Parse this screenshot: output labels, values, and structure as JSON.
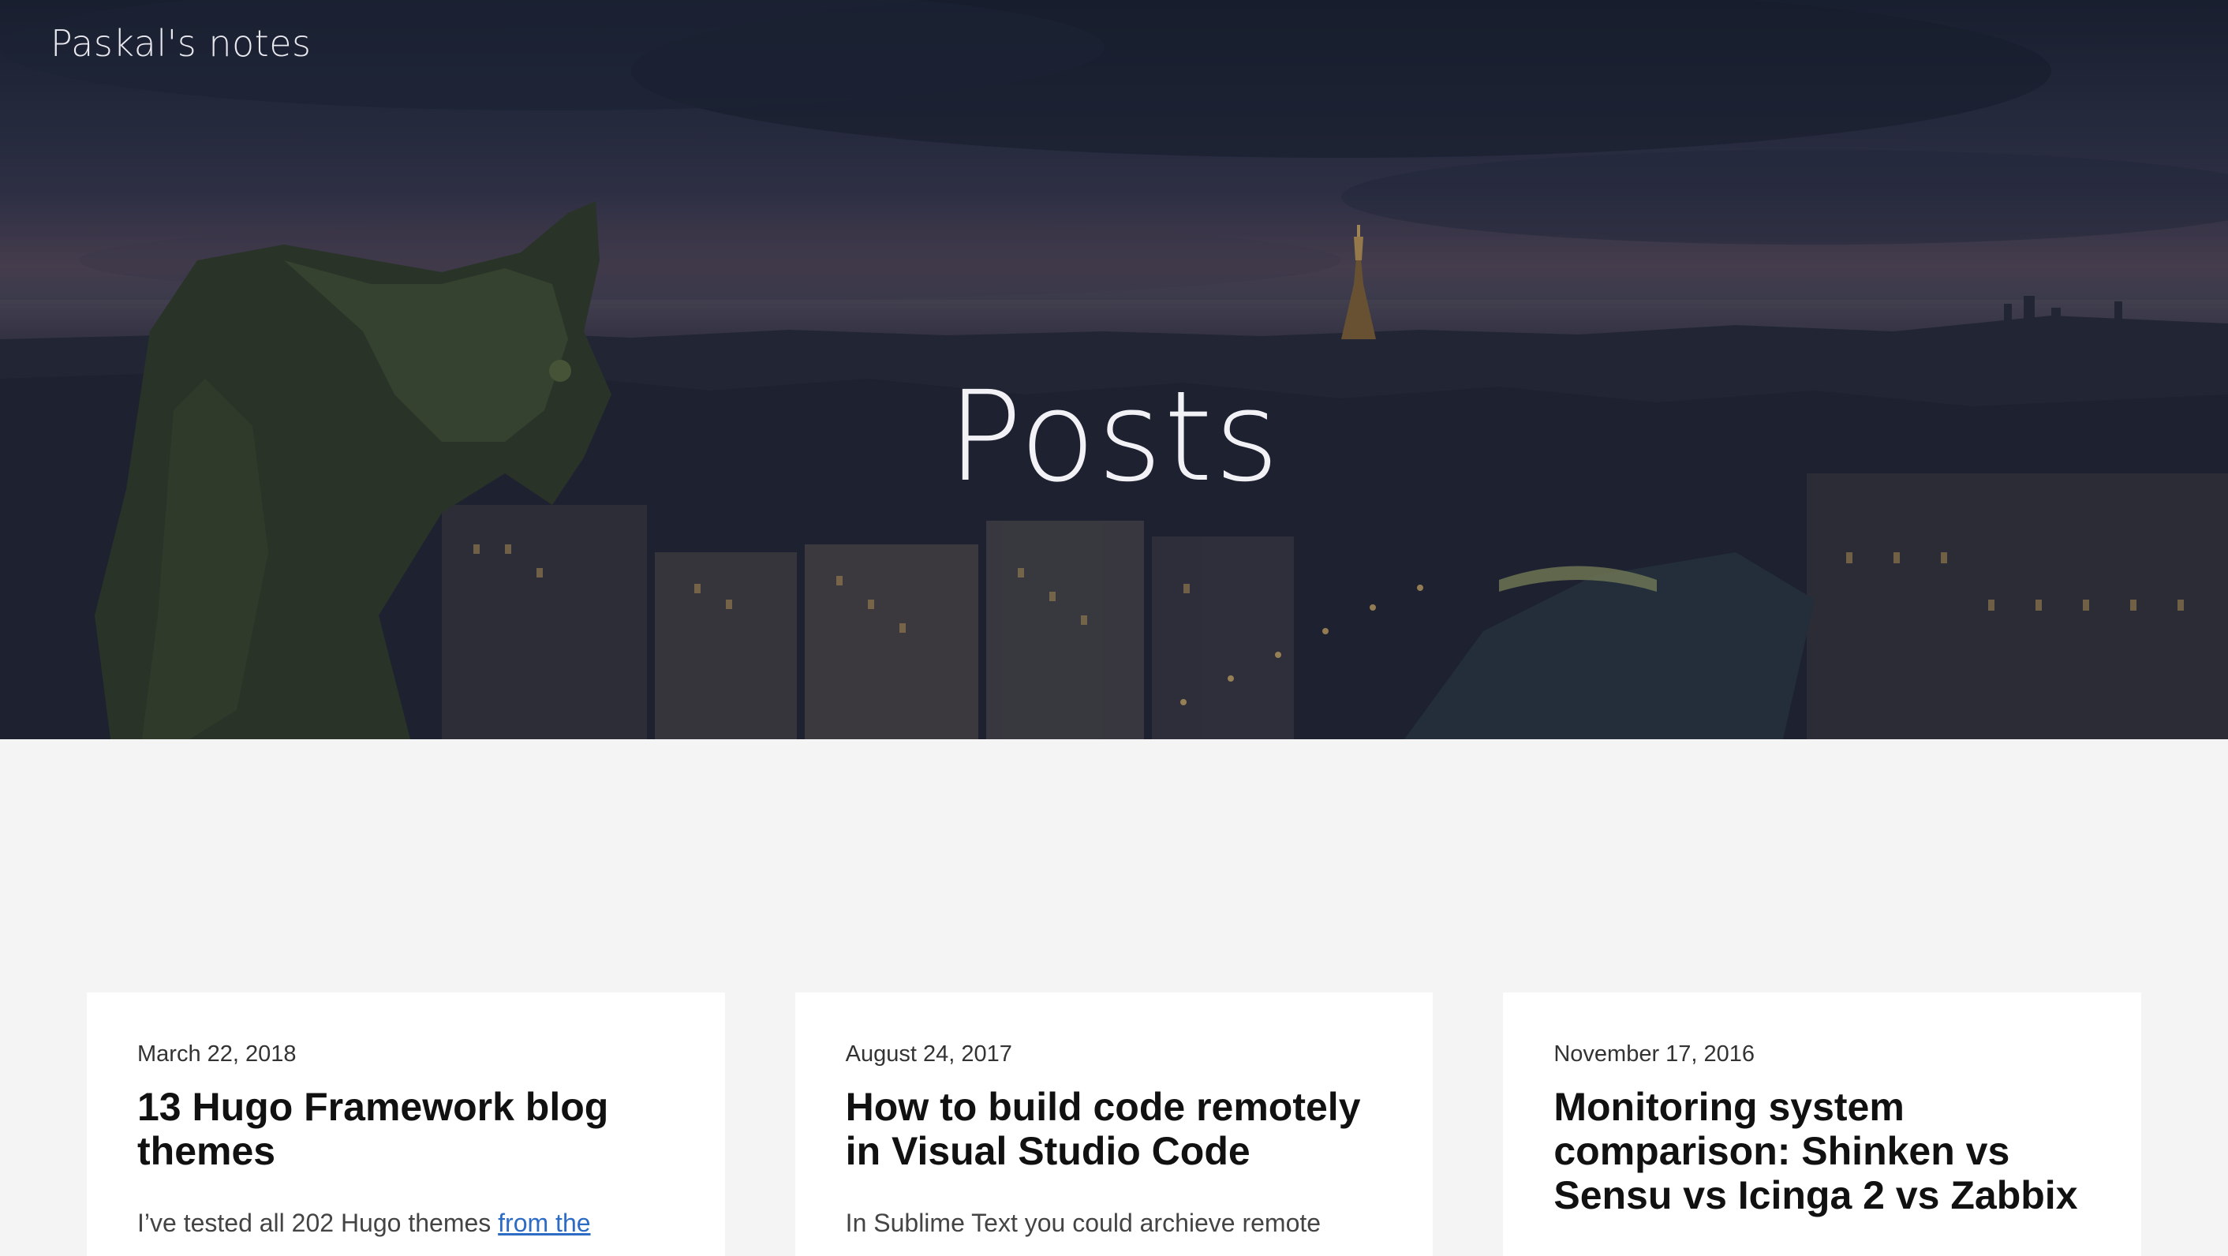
{
  "site": {
    "title": "Paskal's notes"
  },
  "hero": {
    "heading": "Posts"
  },
  "posts": [
    {
      "date": "March 22, 2018",
      "title": "13 Hugo Framework blog themes",
      "excerpt_before_link": "I’ve tested all 202 Hugo themes ",
      "excerpt_link": "from the"
    },
    {
      "date": "August 24, 2017",
      "title": "How to build code remotely in Visual Studio Code",
      "excerpt_before_link": "In Sublime Text you could archieve remote",
      "excerpt_link": ""
    },
    {
      "date": "November 17, 2016",
      "title": "Monitoring system comparison: Shinken vs Sensu vs Icinga 2 vs Zabbix",
      "excerpt_before_link": "",
      "excerpt_link": ""
    }
  ],
  "colors": {
    "page_background": "#f4f4f4",
    "card_background": "#ffffff",
    "link": "#2d6cc5",
    "hero_text": "#f2f2f6"
  }
}
